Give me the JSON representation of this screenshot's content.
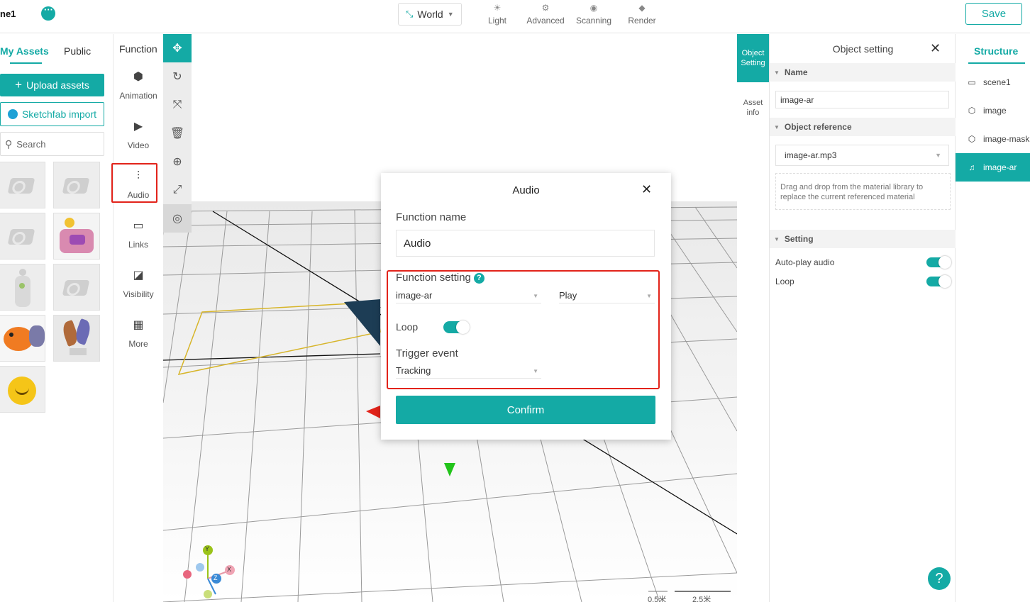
{
  "topbar": {
    "scene_title": "ne1",
    "world_label": "World",
    "tools": [
      {
        "label": "Light",
        "icon": "sun-icon"
      },
      {
        "label": "Advanced",
        "icon": "gear-icon"
      },
      {
        "label": "Scanning",
        "icon": "ar-scan-icon"
      },
      {
        "label": "Render",
        "icon": "paint-bucket-icon"
      }
    ],
    "save_label": "Save"
  },
  "assets": {
    "tabs": [
      "My Assets",
      "Public"
    ],
    "upload_label": "Upload assets",
    "sketchfab_label": "Sketchfab import",
    "search_placeholder": "Search"
  },
  "functions": {
    "title": "Function",
    "items": [
      {
        "label": "Animation",
        "icon": "cube-icon"
      },
      {
        "label": "Video",
        "icon": "play-icon"
      },
      {
        "label": "Audio",
        "icon": "sliders-icon"
      },
      {
        "label": "Links",
        "icon": "link-screen-icon"
      },
      {
        "label": "Visibility",
        "icon": "visibility-icon"
      },
      {
        "label": "More",
        "icon": "grid-icon"
      }
    ]
  },
  "viewport": {
    "scale_labels": [
      "0.5米",
      "2.5米"
    ],
    "axes": [
      "Y",
      "X",
      "Z"
    ]
  },
  "side_tabs": {
    "object_setting": "Object Setting",
    "asset_info": "Asset info"
  },
  "object_setting": {
    "title": "Object setting",
    "name_header": "Name",
    "name_value": "image-ar",
    "reference_header": "Object reference",
    "reference_value": "image-ar.mp3",
    "reference_hint": "Drag and drop from the material library to replace the current referenced material",
    "setting_header": "Setting",
    "autoplay_label": "Auto-play audio",
    "loop_label": "Loop",
    "autoplay_on": true,
    "loop_on": true
  },
  "structure": {
    "title": "Structure",
    "items": [
      {
        "label": "scene1",
        "icon": "scene-icon"
      },
      {
        "label": "image",
        "icon": "cube-icon"
      },
      {
        "label": "image-mask",
        "icon": "cube-icon"
      },
      {
        "label": "image-ar",
        "icon": "music-note-icon",
        "active": true
      }
    ]
  },
  "modal": {
    "title": "Audio",
    "function_name_label": "Function name",
    "function_name_value": "Audio",
    "function_setting_label": "Function setting",
    "target_value": "image-ar",
    "action_value": "Play",
    "loop_label": "Loop",
    "loop_on": true,
    "trigger_label": "Trigger event",
    "trigger_value": "Tracking",
    "confirm_label": "Confirm"
  },
  "colors": {
    "accent": "#14aaa5",
    "highlight": "#e2231a"
  }
}
